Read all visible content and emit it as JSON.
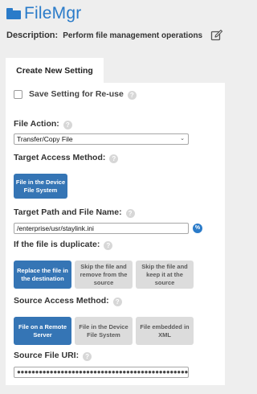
{
  "app": {
    "title": "FileMgr"
  },
  "description": {
    "label": "Description:",
    "value": "Perform file management operations"
  },
  "tabs": [
    {
      "label": "Create New Setting"
    }
  ],
  "save_setting": {
    "label": "Save Setting for Re-use",
    "checked": false
  },
  "help_glyph": "?",
  "file_action": {
    "label": "File Action:",
    "selected": "Transfer/Copy File"
  },
  "target_access": {
    "label": "Target Access Method:",
    "options": [
      "File in the Device File System"
    ],
    "selected_index": 0
  },
  "target_path": {
    "label": "Target Path and File Name:",
    "value": "/enterprise/usr/staylink.ini",
    "macro_glyph": "%"
  },
  "duplicate": {
    "label": "If the file is duplicate:",
    "options": [
      "Replace the file in the destination",
      "Skip the file and remove from the source",
      "Skip the file and keep it at the source"
    ],
    "selected_index": 0
  },
  "source_access": {
    "label": "Source Access Method:",
    "options": [
      "File on a Remote Server",
      "File in the Device File System",
      "File embedded in XML"
    ],
    "selected_index": 0
  },
  "source_uri": {
    "label": "Source File URI:",
    "value": "●●●●●●●●●●●●●●●●●●●●●●●●●●●●●●●●●●●●●●●●●●●●●●●●●●●●●●●●●●●●●"
  },
  "colors": {
    "accent": "#2a7bc9",
    "button_primary": "#3575b5",
    "button_grey": "#dcdcdc",
    "background": "#eeeeee"
  }
}
